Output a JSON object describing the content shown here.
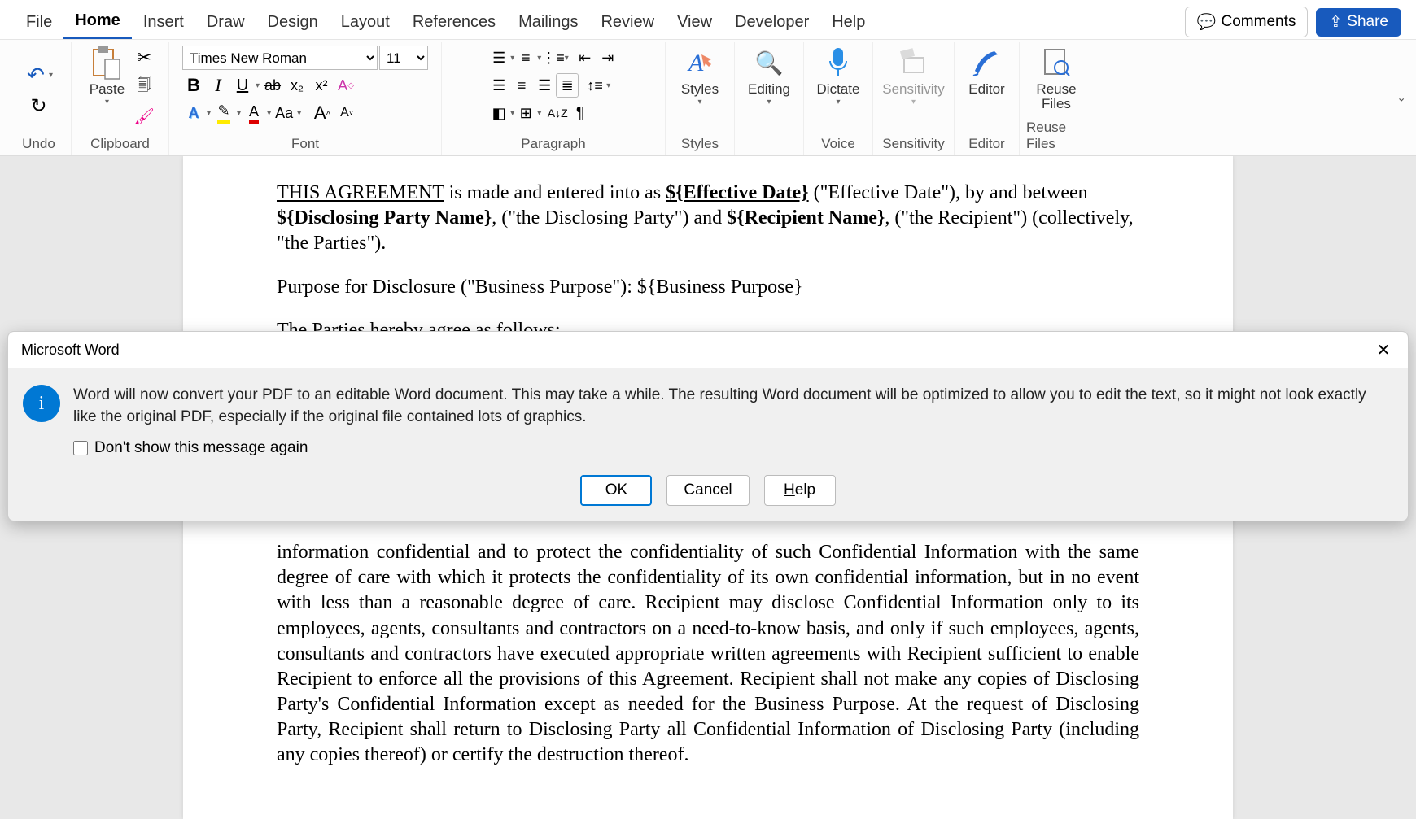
{
  "tabs": {
    "file": "File",
    "home": "Home",
    "insert": "Insert",
    "draw": "Draw",
    "design": "Design",
    "layout": "Layout",
    "references": "References",
    "mailings": "Mailings",
    "review": "Review",
    "view": "View",
    "developer": "Developer",
    "help": "Help"
  },
  "topright": {
    "comments": "Comments",
    "share": "Share"
  },
  "ribbon": {
    "undo": "Undo",
    "clipboard": {
      "label": "Clipboard",
      "paste": "Paste"
    },
    "font": {
      "label": "Font",
      "name": "Times New Roman",
      "size": "11",
      "bold": "B",
      "italic": "I",
      "underline": "U",
      "strike": "ab",
      "sub": "x₂",
      "sup": "x²",
      "clear": "A◇",
      "effects": "A",
      "highlight": "▁",
      "color": "A",
      "case": "Aa",
      "grow": "Aˆ",
      "shrink": "Aˇ"
    },
    "paragraph": {
      "label": "Paragraph",
      "sort": "A↓Z",
      "pilcrow": "¶"
    },
    "styles": {
      "label": "Styles",
      "btn": "Styles"
    },
    "editing": {
      "label": "Editing"
    },
    "dictate": {
      "label": "Voice",
      "btn": "Dictate"
    },
    "sensitivity": {
      "label": "Sensitivity",
      "btn": "Sensitivity"
    },
    "editor": {
      "label": "Editor",
      "btn": "Editor"
    },
    "reuse": {
      "label": "Reuse Files",
      "btn1": "Reuse",
      "btn2": "Files"
    }
  },
  "doc": {
    "p1a": "THIS AGREEMENT",
    "p1b": " is made and entered into as ",
    "p1c": "${Effective Date}",
    "p1d": " (\"Effective Date\"), by and between ",
    "p1e": "${Disclosing Party Name}",
    "p1f": ", (\"the Disclosing Party\") and ",
    "p1g": "${Recipient Name}",
    "p1h": ", (\"the Recipient\") (collectively, \"the Parties\").",
    "p2": "Purpose for Disclosure (\"Business Purpose\"): ${Business Purpose}",
    "p3": "The Parties hereby agree as follows:",
    "p4": "information confidential and to protect the confidentiality of such Confidential Information with the same degree of care with which it protects the confidentiality of its own confidential information, but in no event with less than a reasonable degree of care. Recipient may disclose Confidential Information only to its employees, agents, consultants and contractors on a need-to-know basis, and only if such employees, agents, consultants and contractors have executed appropriate written agreements with Recipient sufficient to enable Recipient to enforce all the provisions of this Agreement. Recipient shall not make any copies of Disclosing Party's Confidential Information except as needed for the Business Purpose. At the request of Disclosing Party, Recipient shall return to Disclosing Party all Confidential Information of Disclosing Party (including any copies thereof) or certify the destruction thereof."
  },
  "dialog": {
    "title": "Microsoft Word",
    "message": "Word will now convert your PDF to an editable Word document. This may take a while. The resulting Word document will be optimized to allow you to edit the text, so it might not look exactly like the original PDF, especially if the original file contained lots of graphics.",
    "checkbox": "Don't show this message again",
    "ok": "OK",
    "cancel": "Cancel",
    "help": "Help"
  }
}
